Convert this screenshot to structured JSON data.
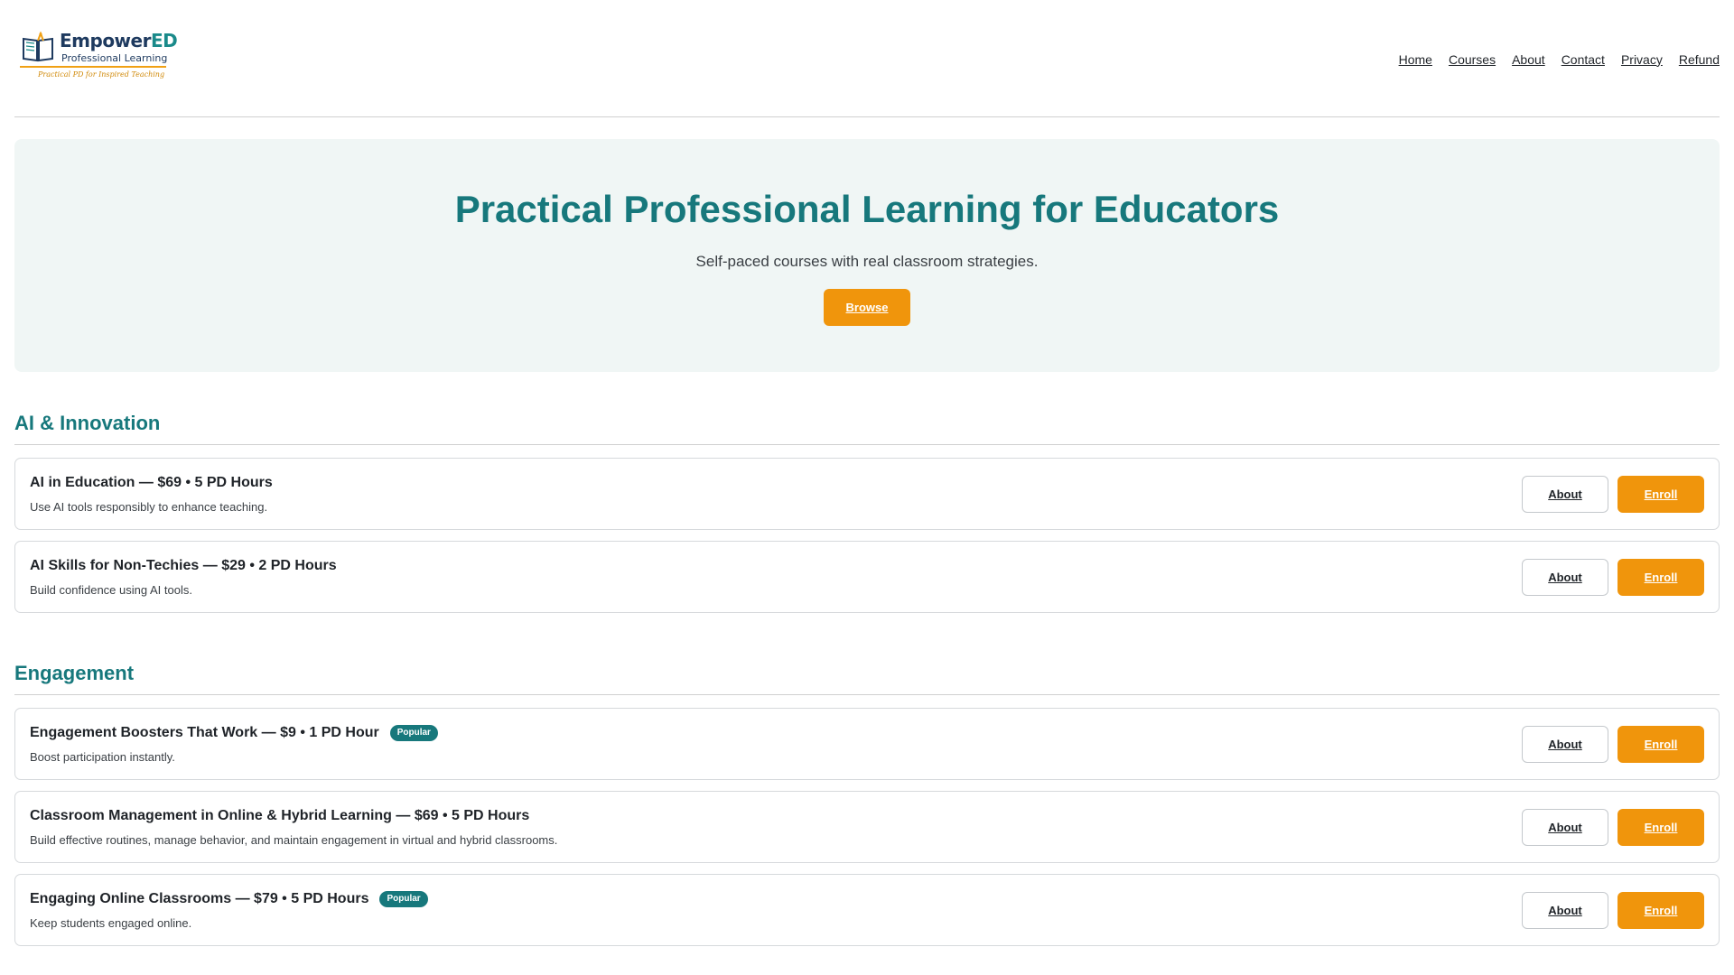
{
  "brand": {
    "name_main": "Empower",
    "name_accent": "ED",
    "subtitle": "Professional Learning",
    "tagline": "Practical PD for Inspired Teaching",
    "icon": "open-book-icon"
  },
  "nav": {
    "items": [
      {
        "label": "Home"
      },
      {
        "label": "Courses"
      },
      {
        "label": "About"
      },
      {
        "label": "Contact"
      },
      {
        "label": "Privacy"
      },
      {
        "label": "Refund"
      }
    ]
  },
  "hero": {
    "title": "Practical Professional Learning for Educators",
    "subtitle": "Self-paced courses with real classroom strategies.",
    "button_label": "Browse"
  },
  "sections": [
    {
      "title": "AI & Innovation",
      "courses": [
        {
          "title": "AI in Education — $69 • 5 PD Hours",
          "badge": "",
          "description": "Use AI tools responsibly to enhance teaching.",
          "about_label": "About",
          "enroll_label": "Enroll"
        },
        {
          "title": "AI Skills for Non-Techies — $29 • 2 PD Hours",
          "badge": "",
          "description": "Build confidence using AI tools.",
          "about_label": "About",
          "enroll_label": "Enroll"
        }
      ]
    },
    {
      "title": "Engagement",
      "courses": [
        {
          "title": "Engagement Boosters That Work — $9 • 1 PD Hour",
          "badge": "Popular",
          "description": "Boost participation instantly.",
          "about_label": "About",
          "enroll_label": "Enroll"
        },
        {
          "title": "Classroom Management in Online & Hybrid Learning — $69 • 5 PD Hours",
          "badge": "",
          "description": "Build effective routines, manage behavior, and maintain engagement in virtual and hybrid classrooms.",
          "about_label": "About",
          "enroll_label": "Enroll"
        },
        {
          "title": "Engaging Online Classrooms — $79 • 5 PD Hours",
          "badge": "Popular",
          "description": "Keep students engaged online.",
          "about_label": "About",
          "enroll_label": "Enroll"
        }
      ]
    }
  ],
  "colors": {
    "accent_teal": "#17787c",
    "accent_orange": "#f0950c",
    "hero_bg": "#f0f6f5"
  }
}
